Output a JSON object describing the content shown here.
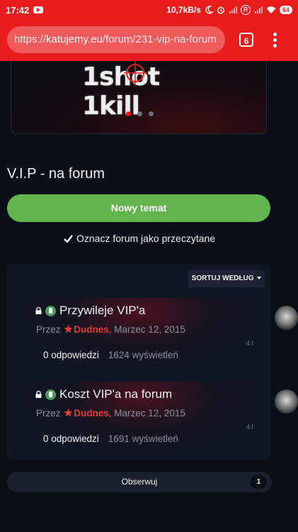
{
  "status": {
    "time": "17:42",
    "speed": "10,7kB/s",
    "battery": "64",
    "r_badge": "R"
  },
  "browser": {
    "url_prefix": "https://",
    "url_domain": "katujemy.eu",
    "url_path": "/forum/231-vip-na-forum",
    "tab_count": "6"
  },
  "banner": {
    "logo_text": "1shot 1kill",
    "slide_count": 3,
    "active_slide": 1
  },
  "page": {
    "title": "V.I.P - na forum",
    "new_topic_label": "Nowy temat",
    "mark_read_label": "Oznacz forum jako przeczytane",
    "sort_label": "SORTUJ WEDŁUG",
    "follow_label": "Obserwuj",
    "follow_count": "1"
  },
  "topics": [
    {
      "title": "Przywileje VIP'a",
      "by": "Przez",
      "author": "Dudnes",
      "date": ", Marzec 12, 2015",
      "replies": "0 odpowiedzi",
      "views": "1624 wyświetleń",
      "side": "4 l"
    },
    {
      "title": "Koszt VIP'a na forum",
      "by": "Przez",
      "author": "Dudnes",
      "date": ", Marzec 12, 2015",
      "replies": "0 odpowiedzi",
      "views": "1691 wyświetleń",
      "side": "4 l"
    }
  ],
  "colors": {
    "brand_red": "#e81c1c",
    "button_green": "#62b54c",
    "pin_green": "#4d9b5c",
    "author_red": "#e03a3a",
    "background": "#0b0f17"
  }
}
